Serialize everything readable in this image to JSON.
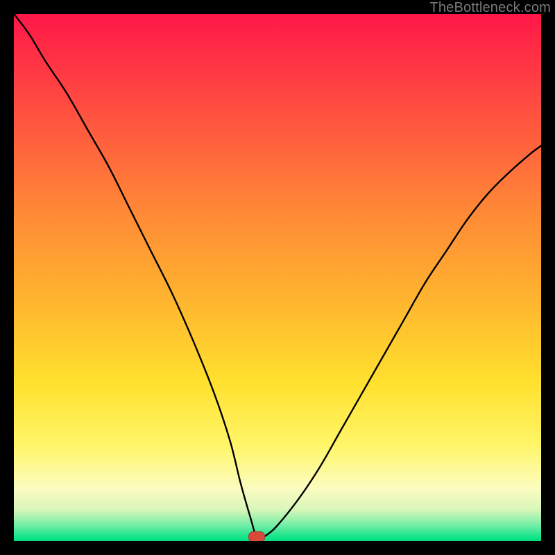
{
  "watermark": {
    "text": "TheBottleneck.com"
  },
  "chart_data": {
    "type": "line",
    "title": "",
    "subtitle": "",
    "xlabel": "",
    "ylabel": "",
    "xlim": [
      0,
      100
    ],
    "ylim": [
      0,
      100
    ],
    "grid": false,
    "legend": false,
    "annotations": [],
    "marker": {
      "x": 46,
      "y": 0.8
    },
    "colors": {
      "background_gradient_top": "#ff1648",
      "background_gradient_mid": "#ffcc2f",
      "background_gradient_bottom": "#00e080",
      "curve": "#000000",
      "marker": "#d9493a",
      "frame": "#000000"
    },
    "series": [
      {
        "name": "bottleneck-curve",
        "x": [
          0,
          3,
          6,
          10,
          14,
          18,
          22,
          26,
          30,
          34,
          38,
          41,
          43,
          45,
          46,
          47,
          48,
          50,
          54,
          58,
          62,
          66,
          70,
          74,
          78,
          82,
          86,
          90,
          94,
          98,
          100
        ],
        "y": [
          100,
          96,
          91,
          85,
          78,
          71,
          63,
          55,
          47,
          38,
          28,
          19,
          11,
          4,
          0.8,
          0.8,
          1.2,
          3,
          8,
          14,
          21,
          28,
          35,
          42,
          49,
          55,
          61,
          66,
          70,
          73.5,
          75
        ]
      }
    ]
  }
}
